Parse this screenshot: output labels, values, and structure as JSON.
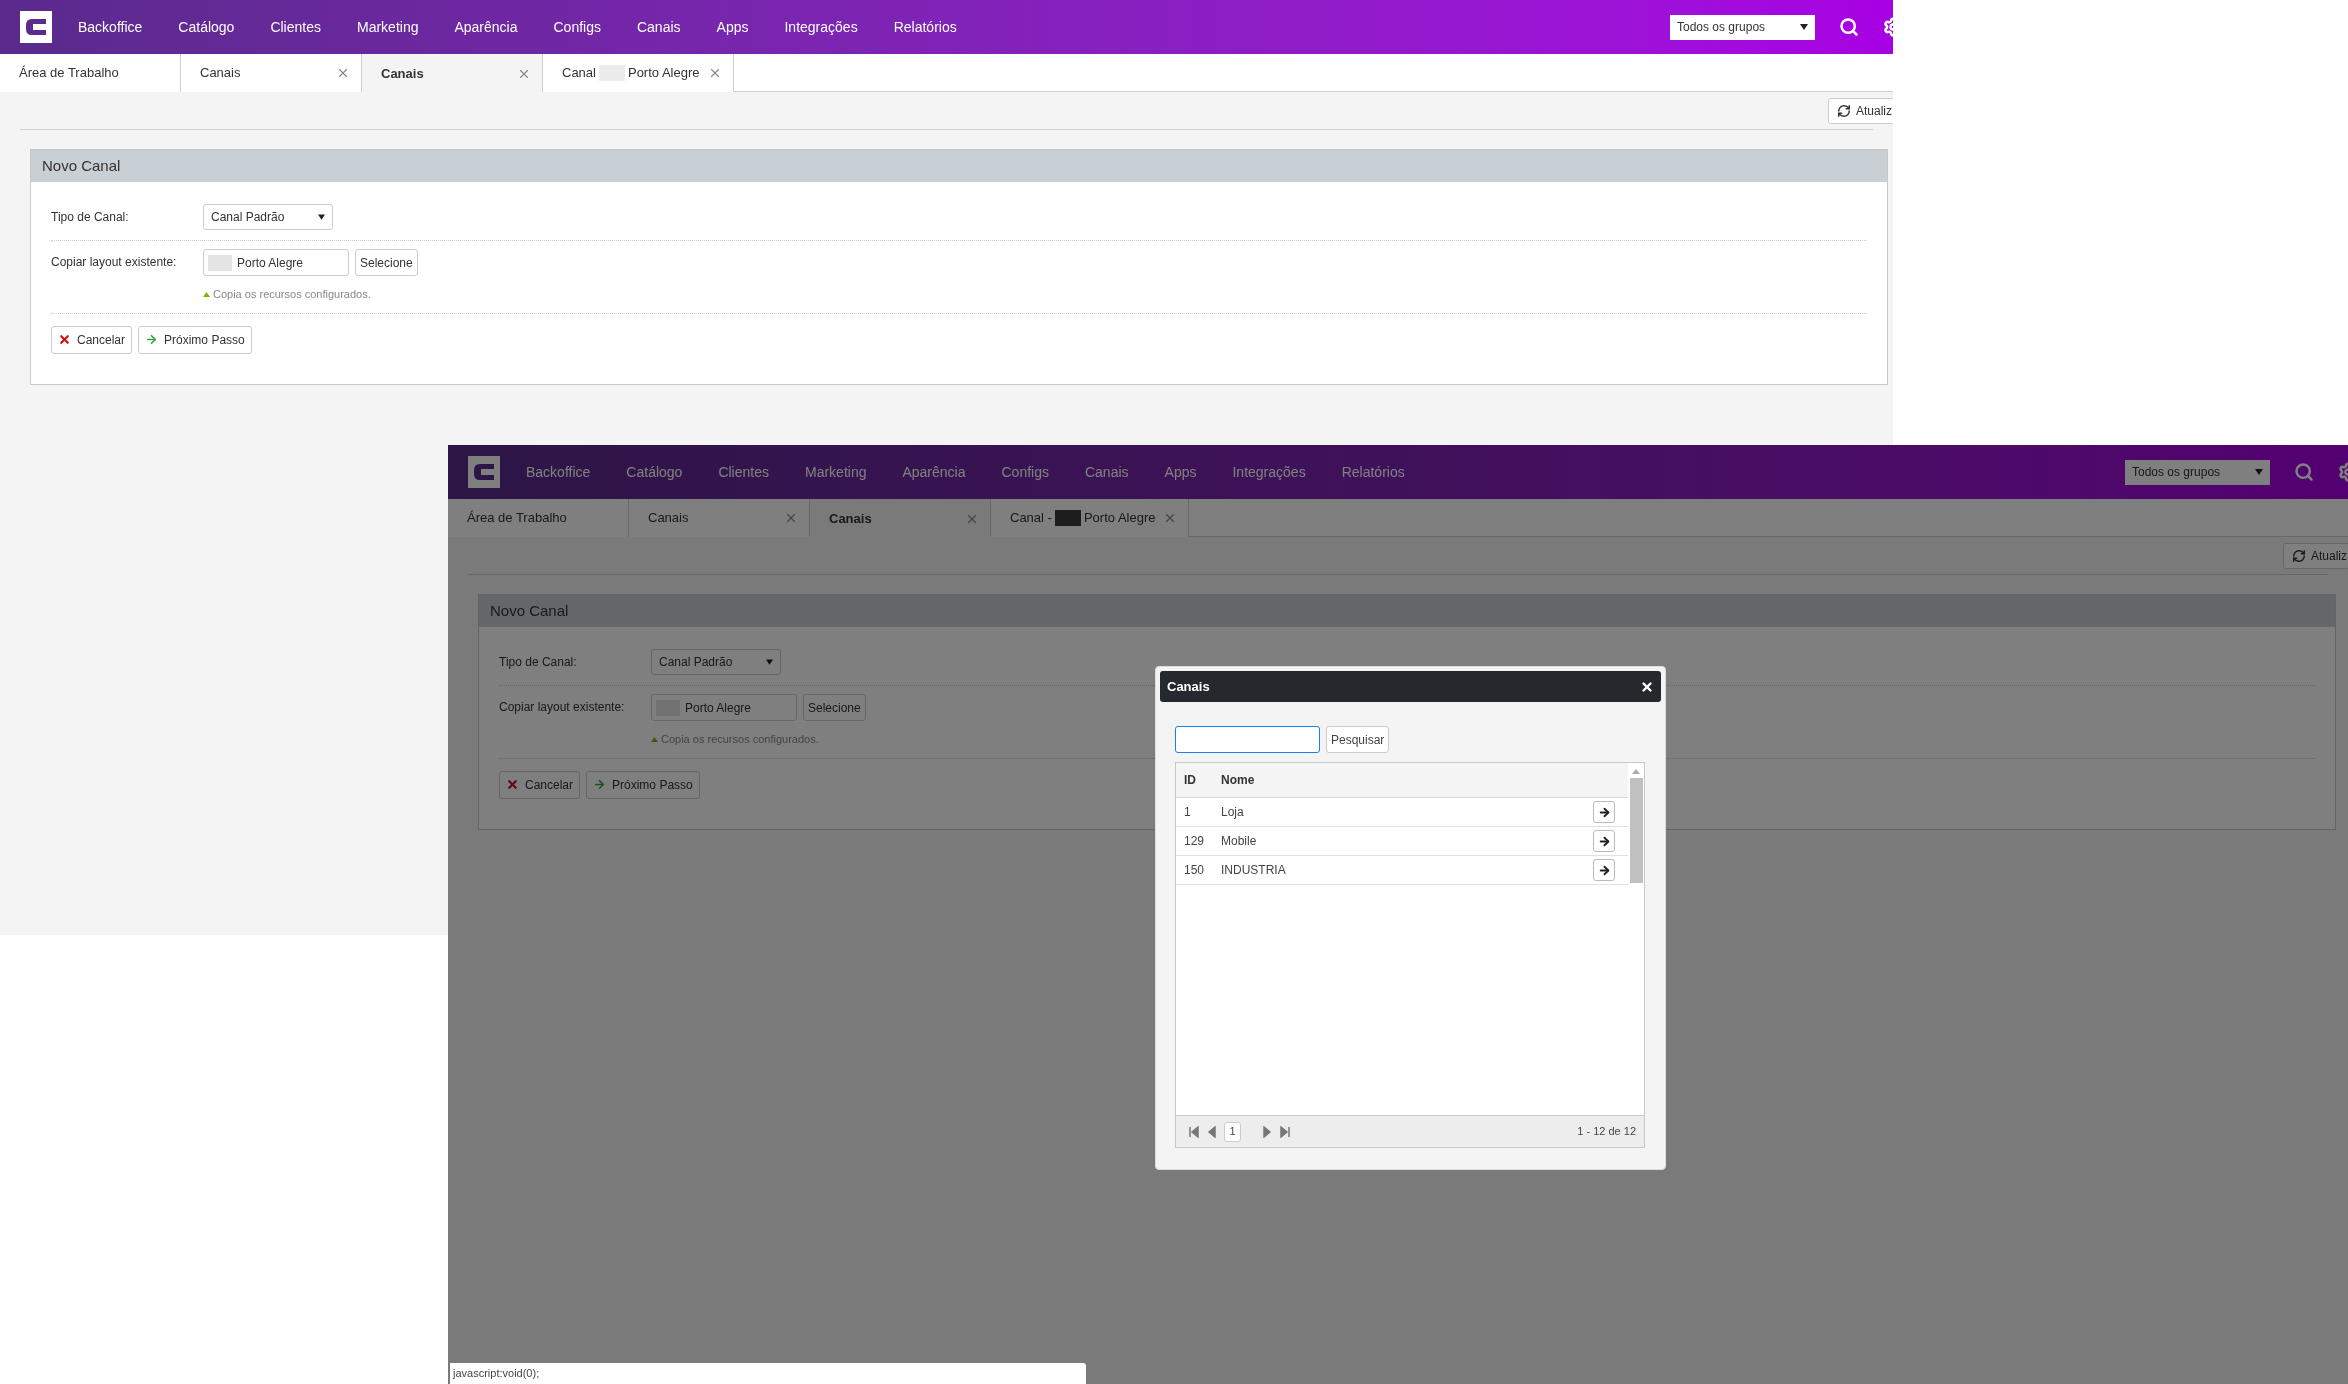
{
  "screens": [
    {
      "dimmed": false,
      "nav": {
        "items": [
          "Backoffice",
          "Catálogo",
          "Clientes",
          "Marketing",
          "Aparência",
          "Configs",
          "Canais",
          "Apps",
          "Integrações",
          "Relatórios"
        ],
        "group_select": "Todos os grupos"
      },
      "tabs": [
        {
          "label_parts": [
            "Área de Trabalho"
          ],
          "closable": false,
          "selected": false
        },
        {
          "label_parts": [
            "Canais"
          ],
          "closable": true,
          "selected": false
        },
        {
          "label_parts": [
            "Canais"
          ],
          "closable": true,
          "selected": true
        },
        {
          "label_parts": [
            "Canal",
            "Porto Alegre"
          ],
          "closable": true,
          "selected": false
        }
      ],
      "toolbar": {
        "refresh": "Atualiz"
      },
      "panel": {
        "title": "Novo Canal",
        "fields": [
          {
            "kind": "select",
            "label": "Tipo de Canal:",
            "value": "Canal Padrão"
          },
          {
            "kind": "lookup",
            "label": "Copiar layout existente:",
            "value": "Porto Alegre",
            "button": "Selecione",
            "hint": "Copia os recursos configurados."
          }
        ],
        "buttons": [
          {
            "kind": "cancel",
            "label": "Cancelar"
          },
          {
            "kind": "next",
            "label": "Próximo Passo"
          }
        ]
      }
    },
    {
      "dimmed": true,
      "nav": {
        "items": [
          "Backoffice",
          "Catálogo",
          "Clientes",
          "Marketing",
          "Aparência",
          "Configs",
          "Canais",
          "Apps",
          "Integrações",
          "Relatórios"
        ],
        "group_select": "Todos os grupos"
      },
      "tabs": [
        {
          "label_parts": [
            "Área de Trabalho"
          ],
          "closable": false,
          "selected": false
        },
        {
          "label_parts": [
            "Canais"
          ],
          "closable": true,
          "selected": false
        },
        {
          "label_parts": [
            "Canais"
          ],
          "closable": true,
          "selected": true
        },
        {
          "label_parts": [
            "Canal -",
            "Porto Alegre"
          ],
          "closable": true,
          "selected": false
        }
      ],
      "toolbar": {
        "refresh": "Atualiz"
      },
      "panel": {
        "title": "Novo Canal",
        "fields": [
          {
            "kind": "select",
            "label": "Tipo de Canal:",
            "value": "Canal Padrão"
          },
          {
            "kind": "lookup",
            "label": "Copiar layout existente:",
            "value": "Porto Alegre",
            "button": "Selecione",
            "hint": "Copia os recursos configurados."
          }
        ],
        "buttons": [
          {
            "kind": "cancel",
            "label": "Cancelar"
          },
          {
            "kind": "next",
            "label": "Próximo Passo"
          }
        ]
      },
      "modal": {
        "title": "Canais",
        "search_button": "Pesquisar",
        "columns": [
          "ID",
          "Nome"
        ],
        "rows": [
          {
            "id": "1",
            "name": "Loja"
          },
          {
            "id": "129",
            "name": "Mobile"
          },
          {
            "id": "150",
            "name": "INDUSTRIA"
          }
        ],
        "pager": {
          "page": "1",
          "summary": "1 - 12 de 12"
        }
      },
      "status_bar": "javascript:void(0);"
    }
  ]
}
